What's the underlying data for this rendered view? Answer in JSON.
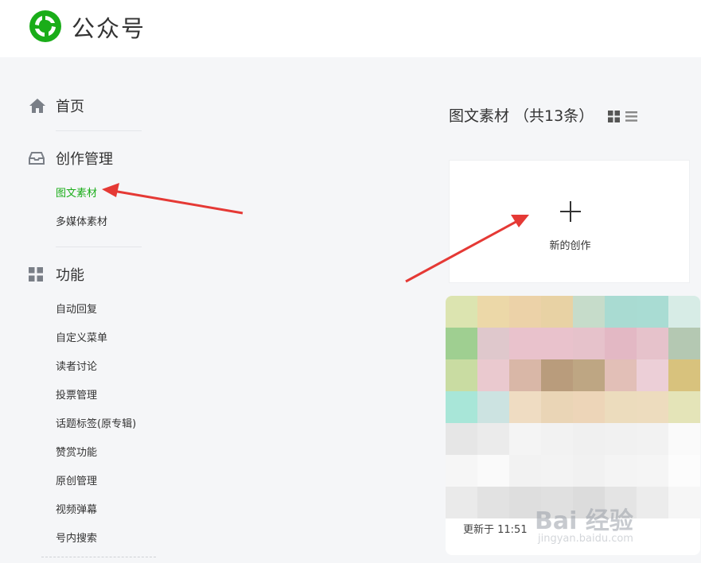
{
  "app": {
    "title": "公众号",
    "brand_color": "#1aad19"
  },
  "sidebar": {
    "home": {
      "label": "首页",
      "icon": "home-icon"
    },
    "creation": {
      "label": "创作管理",
      "icon": "inbox-icon",
      "items": [
        {
          "label": "图文素材",
          "active": true
        },
        {
          "label": "多媒体素材",
          "active": false
        }
      ]
    },
    "features": {
      "label": "功能",
      "icon": "grid-icon",
      "items": [
        {
          "label": "自动回复"
        },
        {
          "label": "自定义菜单"
        },
        {
          "label": "读者讨论"
        },
        {
          "label": "投票管理"
        },
        {
          "label": "话题标签(原专辑)"
        },
        {
          "label": "赞赏功能"
        },
        {
          "label": "原创管理"
        },
        {
          "label": "视频弹幕"
        },
        {
          "label": "号内搜索"
        }
      ]
    }
  },
  "main": {
    "title": "图文素材 （共13条）",
    "new_card": {
      "label": "新的创作"
    },
    "article": {
      "updated": "更新于 11:51"
    }
  },
  "watermark": {
    "brand": "Bai 经验",
    "site": "jingyan.baidu.com"
  },
  "annotation_color": "#e53935"
}
